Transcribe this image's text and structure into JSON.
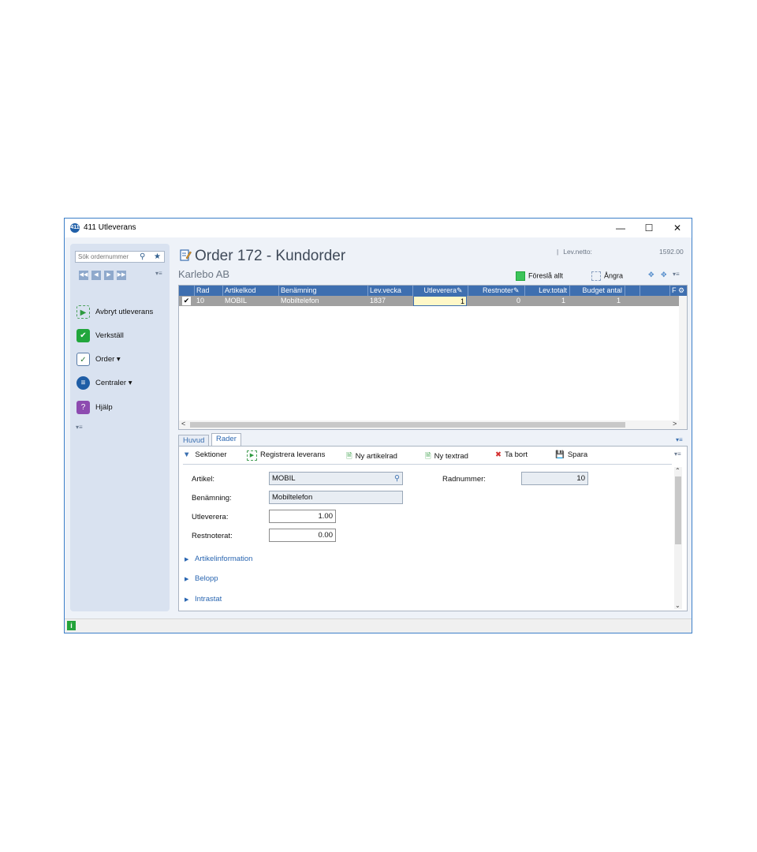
{
  "window": {
    "icon_text": "411",
    "title": "411 Utleverans",
    "minimize": "—",
    "maximize": "☐",
    "close": "✕"
  },
  "sidebar": {
    "search_placeholder": "Sök ordernummer",
    "actions": [
      {
        "label": "Avbryt utleverans",
        "icon": "play-dashed-icon"
      },
      {
        "label": "Verkställ",
        "icon": "checkmark-icon"
      },
      {
        "label": "Order ▾",
        "icon": "order-icon"
      },
      {
        "label": "Centraler ▾",
        "icon": "central-icon"
      },
      {
        "label": "Hjälp",
        "icon": "help-icon"
      }
    ]
  },
  "header": {
    "order_title": "Order 172 - Kundorder",
    "customer": "Karlebo AB",
    "lev_netto_label": "Lev.netto:",
    "lev_netto_value": "1592.00",
    "foresla_allt": "Föreslå allt",
    "angra": "Ångra"
  },
  "grid": {
    "columns": [
      "Rad",
      "Artikelkod",
      "Benämning",
      "Lev.vecka",
      "Utleverera",
      "Restnoter",
      "Lev.totalt",
      "Budget antal",
      "",
      "",
      "F"
    ],
    "rows": [
      {
        "selected": true,
        "rad": "10",
        "artikelkod": "MOBIL",
        "benamning": "Mobiltelefon",
        "levvecka": "1837",
        "utleverera": "1",
        "restnoter": "0",
        "levtotalt": "1",
        "budget": "1"
      }
    ]
  },
  "tabs": [
    "Huvud",
    "Rader"
  ],
  "active_tab": "Rader",
  "panel_toolbar": [
    "Sektioner",
    "Registrera leverans",
    "Ny artikelrad",
    "Ny textrad",
    "Ta bort",
    "Spara"
  ],
  "form": {
    "artikel_label": "Artikel:",
    "artikel_value": "MOBIL",
    "benamning_label": "Benämning:",
    "benamning_value": "Mobiltelefon",
    "utleverera_label": "Utleverera:",
    "utleverera_value": "1.00",
    "restnoterat_label": "Restnoterat:",
    "restnoterat_value": "0.00",
    "radnummer_label": "Radnummer:",
    "radnummer_value": "10"
  },
  "sections": [
    "Artikelinformation",
    "Belopp",
    "Intrastat"
  ],
  "status": {
    "info_icon": "i"
  }
}
